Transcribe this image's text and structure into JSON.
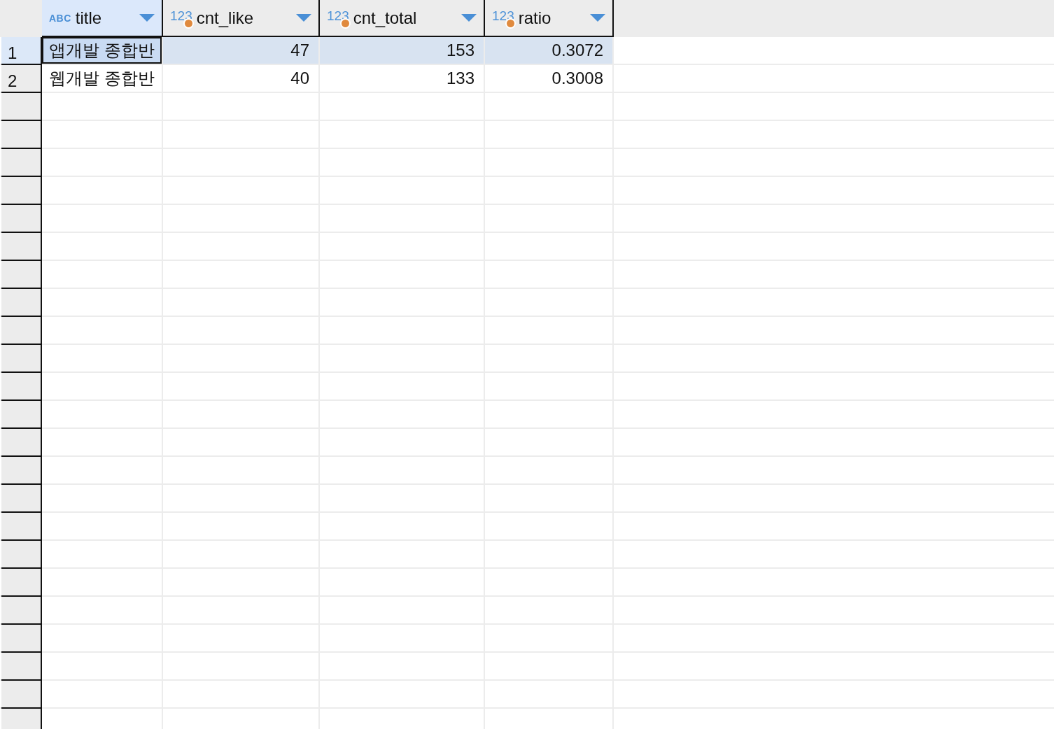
{
  "columns": [
    {
      "type_glyph": "ABC",
      "kind": "text",
      "label": "title",
      "selected": true
    },
    {
      "type_glyph": "123",
      "kind": "number",
      "label": "cnt_like",
      "selected": false
    },
    {
      "type_glyph": "123",
      "kind": "number",
      "label": "cnt_total",
      "selected": false
    },
    {
      "type_glyph": "123",
      "kind": "number",
      "label": "ratio",
      "selected": false
    }
  ],
  "rows": [
    {
      "number": "1",
      "selected": true,
      "cells": [
        {
          "text": "앱개발 종합반",
          "focused": true
        },
        {
          "text": "47",
          "focused": false
        },
        {
          "text": "153",
          "focused": false
        },
        {
          "text": "0.3072",
          "focused": false
        }
      ]
    },
    {
      "number": "2",
      "selected": false,
      "cells": [
        {
          "text": "웹개발 종합반",
          "focused": false
        },
        {
          "text": "40",
          "focused": false
        },
        {
          "text": "133",
          "focused": false
        },
        {
          "text": "0.3008",
          "focused": false
        }
      ]
    }
  ]
}
